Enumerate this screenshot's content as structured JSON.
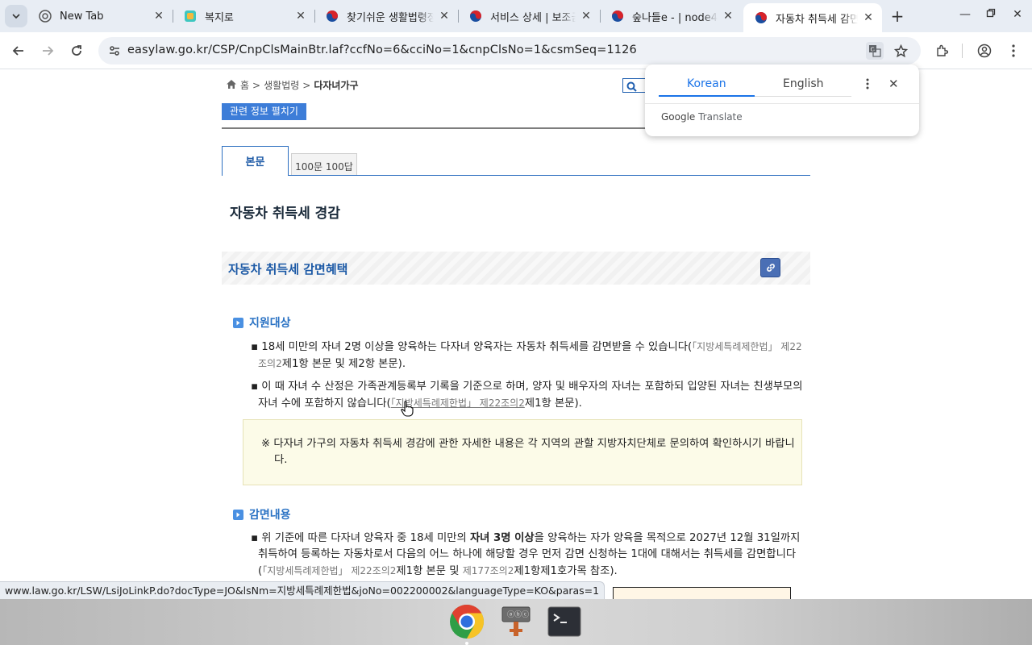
{
  "tabs": [
    {
      "title": "New Tab"
    },
    {
      "title": "복지로"
    },
    {
      "title": "찾기쉬운 생활법령정보"
    },
    {
      "title": "서비스 상세 | 보조금24"
    },
    {
      "title": "숲나들e - | node4"
    },
    {
      "title": "자동차 취득세 감면"
    }
  ],
  "address_bar": {
    "url": "easylaw.go.kr/CSP/CnpClsMainBtr.laf?ccfNo=6&cciNo=1&cnpClsNo=1&csmSeq=1126"
  },
  "translate_popup": {
    "lang_source": "Korean",
    "lang_target": "English",
    "brand_google": "Google",
    "brand_translate": "Translate"
  },
  "page": {
    "breadcrumb": {
      "home": "홈",
      "sep": ">",
      "level1": "생활법령",
      "current": "다자녀가구"
    },
    "related_info_button": "관련 정보 펼치기",
    "tabs": {
      "body": "본문",
      "qa": "100문 100답"
    },
    "title": "자동차 취득세 경감",
    "section_title": "자동차 취득세 감면혜택",
    "subsections": [
      {
        "heading": "지원대상",
        "paragraphs": [
          {
            "text": "18세 미만의 자녀 2명 이상을 양육하는 다자녀 양육자는 자동차 취득세를 감면받을 수 있습니다(",
            "law": "「지방세특례제한법」 제22조의2",
            "tail": "제1항 본문 및 제2항 본문)."
          },
          {
            "text": "이 때 자녀 수 산정은 가족관계등록부 기록을 기준으로 하며, 양자 및 배우자의 자녀는 포함하되 입양된 자녀는 친생부모의 자녀 수에 포함하지 않습니다(",
            "law": "「지방세특례제한법」 제22조의2",
            "tail": "제1항 본문)."
          }
        ],
        "note": "※ 다자녀 가구의 자동차 취득세 경감에 관한 자세한 내용은 각 지역의 관할 지방자치단체로 문의하여 확인하시기 바랍니다."
      },
      {
        "heading": "감면내용",
        "paragraph": {
          "pre": "위 기준에 따른 다자녀 양육자 중 18세 미만의 ",
          "bold": "자녀 3명 이상",
          "mid": "을 양육하는 자가 양육을 목적으로 2027년 12월 31일까지 취득하여 등록하는 자동차로서 다음의 어느 하나에 해당할 경우 먼저 감면 신청하는 1대에 대해서는 취득세를 감면합니다(",
          "law1": "「지방세특례제한법」 제22조의2",
          "mid2": "제1항 본문 및 ",
          "law2": "제177조의2",
          "tail": "제1항제1호가목 참조)."
        }
      }
    ]
  },
  "status_link": "www.law.go.kr/LSW/LsiJoLinkP.do?docType=JO&lsNm=지방세특례제한법&joNo=002200002&languageType=KO&paras=1",
  "colors": {
    "accent": "#1d5aa6",
    "link_blue": "#2b73c4",
    "chrome_tab_bg": "#e8edf4"
  }
}
